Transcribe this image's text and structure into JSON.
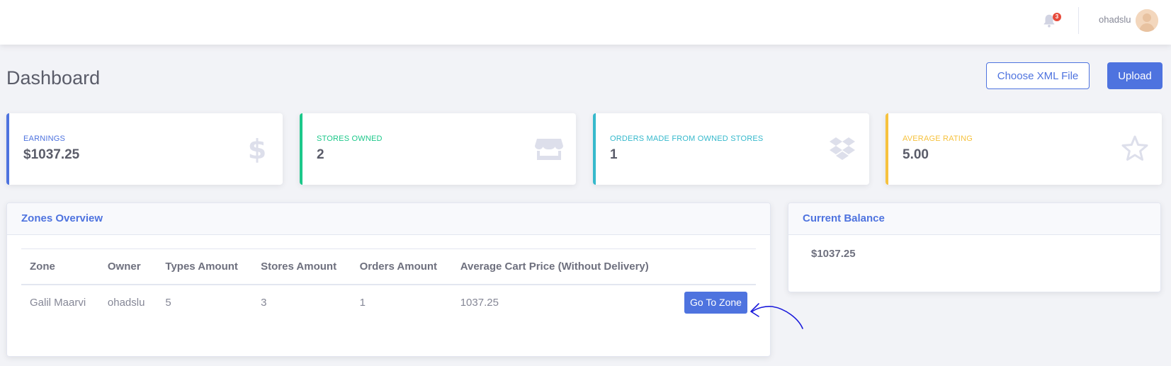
{
  "topbar": {
    "notification_count": "3",
    "bell_icon": "bell-icon",
    "username": "ohadslu",
    "avatar_icon": "user-avatar"
  },
  "page": {
    "title": "Dashboard",
    "choose_file_label": "Choose XML File",
    "upload_label": "Upload"
  },
  "stats": [
    {
      "label": "EARNINGS",
      "value": "$1037.25",
      "color": "#4e73df",
      "icon": "dollar-icon"
    },
    {
      "label": "STORES OWNED",
      "value": "2",
      "color": "#1cc88a",
      "icon": "store-icon"
    },
    {
      "label": "ORDERS MADE FROM OWNED STORES",
      "value": "1",
      "color": "#36b9cc",
      "icon": "dropbox-icon"
    },
    {
      "label": "AVERAGE RATING",
      "value": "5.00",
      "color": "#f6c23e",
      "icon": "star-icon"
    }
  ],
  "zones": {
    "title": "Zones Overview",
    "columns": [
      "Zone",
      "Owner",
      "Types Amount",
      "Stores Amount",
      "Orders Amount",
      "Average Cart Price (Without Delivery)"
    ],
    "rows": [
      {
        "zone": "Galil Maarvi",
        "owner": "ohadslu",
        "types": "5",
        "stores": "3",
        "orders": "1",
        "avg_price": "1037.25",
        "action": "Go To Zone"
      }
    ]
  },
  "balance": {
    "title": "Current Balance",
    "value": "$1037.25"
  },
  "colors": {
    "primary": "#4e73df",
    "success": "#1cc88a",
    "info": "#36b9cc",
    "warning": "#f6c23e",
    "icon_gray": "#dddfeb"
  }
}
